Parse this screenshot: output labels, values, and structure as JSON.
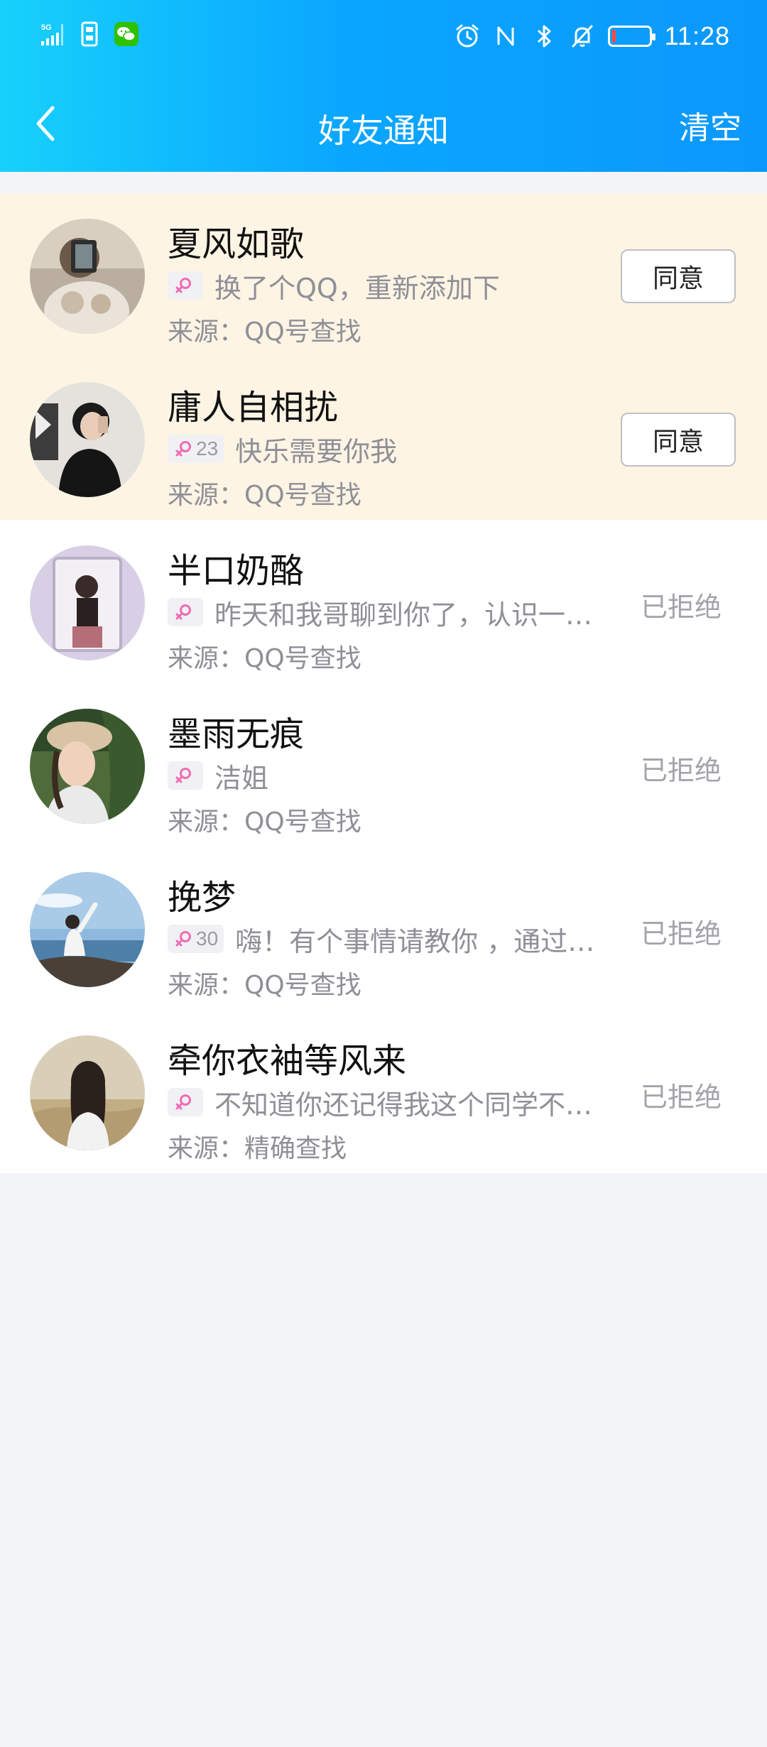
{
  "status_bar": {
    "network": "5G",
    "time": "11:28",
    "icons": [
      "5g-signal-icon",
      "sim-icon",
      "wechat-icon",
      "alarm-icon",
      "nfc-icon",
      "bluetooth-icon",
      "mute-icon",
      "battery-icon"
    ],
    "battery_level_fraction": 0.08
  },
  "header": {
    "back_icon": "chevron-left-icon",
    "title": "好友通知",
    "clear_label": "清空"
  },
  "colors": {
    "header_gradient_start": "#17d1fb",
    "header_gradient_end": "#0b98fb",
    "pending_row_bg": "#fdf4e4",
    "female_icon": "#f06bb4",
    "page_bg": "#f3f4f8"
  },
  "requests": [
    {
      "name": "夏风如歌",
      "gender_icon": "female-icon",
      "age": "",
      "message": "换了个QQ，重新添加下",
      "source": "来源：QQ号查找",
      "action_label": "同意",
      "status": "pending"
    },
    {
      "name": "庸人自相扰",
      "gender_icon": "female-icon",
      "age": "23",
      "message": "快乐需要你我",
      "source": "来源：QQ号查找",
      "action_label": "同意",
      "status": "pending"
    },
    {
      "name": "半口奶酪",
      "gender_icon": "female-icon",
      "age": "",
      "message": "昨天和我哥聊到你了，认识一…",
      "source": "来源：QQ号查找",
      "action_label": "已拒绝",
      "status": "rejected"
    },
    {
      "name": "墨雨无痕",
      "gender_icon": "female-icon",
      "age": "",
      "message": "洁姐",
      "source": "来源：QQ号查找",
      "action_label": "已拒绝",
      "status": "rejected"
    },
    {
      "name": "挽梦",
      "gender_icon": "female-icon",
      "age": "30",
      "message": "嗨！有个事情请教你 ，通过…",
      "source": "来源：QQ号查找",
      "action_label": "已拒绝",
      "status": "rejected"
    },
    {
      "name": "牵你衣袖等风来",
      "gender_icon": "female-icon",
      "age": "",
      "message": "不知道你还记得我这个同学不…",
      "source": "来源：精确查找",
      "action_label": "已拒绝",
      "status": "rejected"
    }
  ]
}
